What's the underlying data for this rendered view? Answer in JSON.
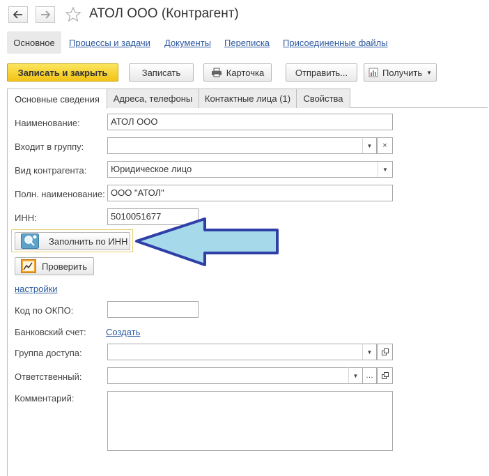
{
  "window": {
    "title": "АТОЛ ООО (Контрагент)",
    "back_icon": "arrow-left-icon",
    "forward_icon": "arrow-right-icon",
    "favorite_icon": "star-icon"
  },
  "nav": {
    "active": "Основное",
    "links": [
      "Процессы и задачи",
      "Документы",
      "Переписка",
      "Присоединенные файлы"
    ]
  },
  "toolbar": {
    "save_close": "Записать и закрыть",
    "save": "Записать",
    "card": "Карточка",
    "send": "Отправить...",
    "get": "Получить"
  },
  "tabs": [
    "Основные сведения",
    "Адреса, телефоны",
    "Контактные лица (1)",
    "Свойства"
  ],
  "form": {
    "name_label": "Наименование:",
    "name_value": "АТОЛ ООО",
    "group_label": "Входит в группу:",
    "group_value": "",
    "kind_label": "Вид контрагента:",
    "kind_value": "Юридическое лицо",
    "fullname_label": "Полн. наименование:",
    "fullname_value": "ООО \"АТОЛ\"",
    "inn_label": "ИНН:",
    "inn_value": "5010051677",
    "fill_by_inn": "Заполнить по ИНН",
    "check": "Проверить",
    "settings_link": "настройки",
    "okpo_label": "Код по ОКПО:",
    "okpo_value": "",
    "bank_label": "Банковский счет:",
    "bank_link": "Создать",
    "access_label": "Группа доступа:",
    "access_value": "",
    "responsible_label": "Ответственный:",
    "responsible_value": "",
    "comment_label": "Комментарий:",
    "comment_value": ""
  },
  "annotation": {
    "arrow_color": "#a6d9ea",
    "arrow_border": "#2f3fa8"
  }
}
